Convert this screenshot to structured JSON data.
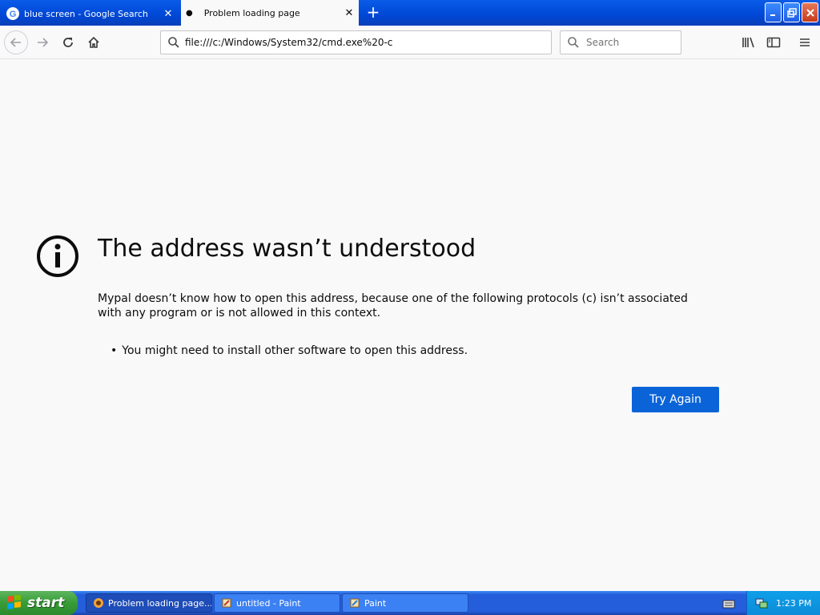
{
  "browser": {
    "tabs": [
      {
        "label": "blue screen - Google Search",
        "icon": "google-icon",
        "active": false
      },
      {
        "label": "Problem loading page",
        "icon": "loading-dot",
        "active": true
      }
    ],
    "new_tab_icon": "plus-icon",
    "url": "file:///c:/Windows/System32/cmd.exe%20-c",
    "search_placeholder": "Search"
  },
  "page": {
    "title": "The address wasn’t understood",
    "description": "Mypal doesn’t know how to open this address, because one of the following protocols (c) isn’t associated with any program or is not allowed in this context.",
    "bullets": [
      "You might need to install other software to open this address."
    ],
    "try_again_label": "Try Again"
  },
  "taskbar": {
    "start_label": "start",
    "tasks": [
      {
        "label": "Problem loading page...",
        "active": true
      },
      {
        "label": "untitled - Paint",
        "active": false
      },
      {
        "label": "Paint",
        "active": false
      }
    ],
    "clock": "1:23 PM"
  },
  "colors": {
    "titlebar_blue": "#0047d6",
    "page_bg": "#f9f9fa",
    "button_blue": "#0a64d8",
    "taskbar_blue": "#245edb",
    "start_green": "#379c37"
  }
}
